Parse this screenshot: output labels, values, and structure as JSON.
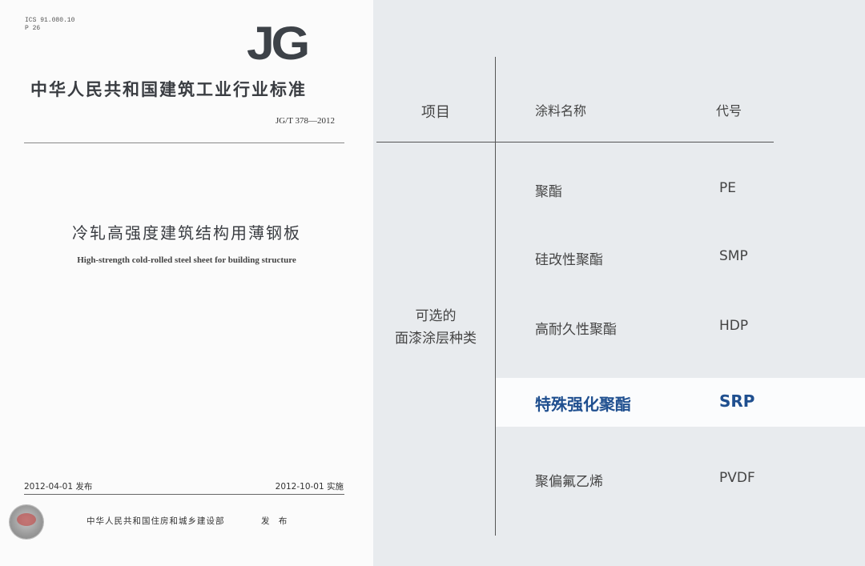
{
  "cover": {
    "ics_line": "ICS 91.080.10",
    "p_line": "P 26",
    "logo_text": "JG",
    "org_name": "中华人民共和国建筑工业行业标准",
    "standard_code": "JG/T 378—2012",
    "title_cn": "冷轧高强度建筑结构用薄钢板",
    "title_en": "High-strength cold-rolled steel sheet for building structure",
    "issue_date": "2012-04-01 发布",
    "effective_date": "2012-10-01 实施",
    "publisher": "中华人民共和国住房和城乡建设部",
    "publish_word": "发 布"
  },
  "table": {
    "header_item": "项目",
    "header_name": "涂料名称",
    "header_code": "代号",
    "row_label_line1": "可选的",
    "row_label_line2": "面漆涂层种类",
    "rows": [
      {
        "name": "聚酯",
        "code": "PE"
      },
      {
        "name": "硅改性聚酯",
        "code": "SMP"
      },
      {
        "name": "高耐久性聚酯",
        "code": "HDP"
      },
      {
        "name": "特殊强化聚酯",
        "code": "SRP"
      },
      {
        "name": "聚偏氟乙烯",
        "code": "PVDF"
      }
    ],
    "highlight_color": "#1f4f8f"
  }
}
